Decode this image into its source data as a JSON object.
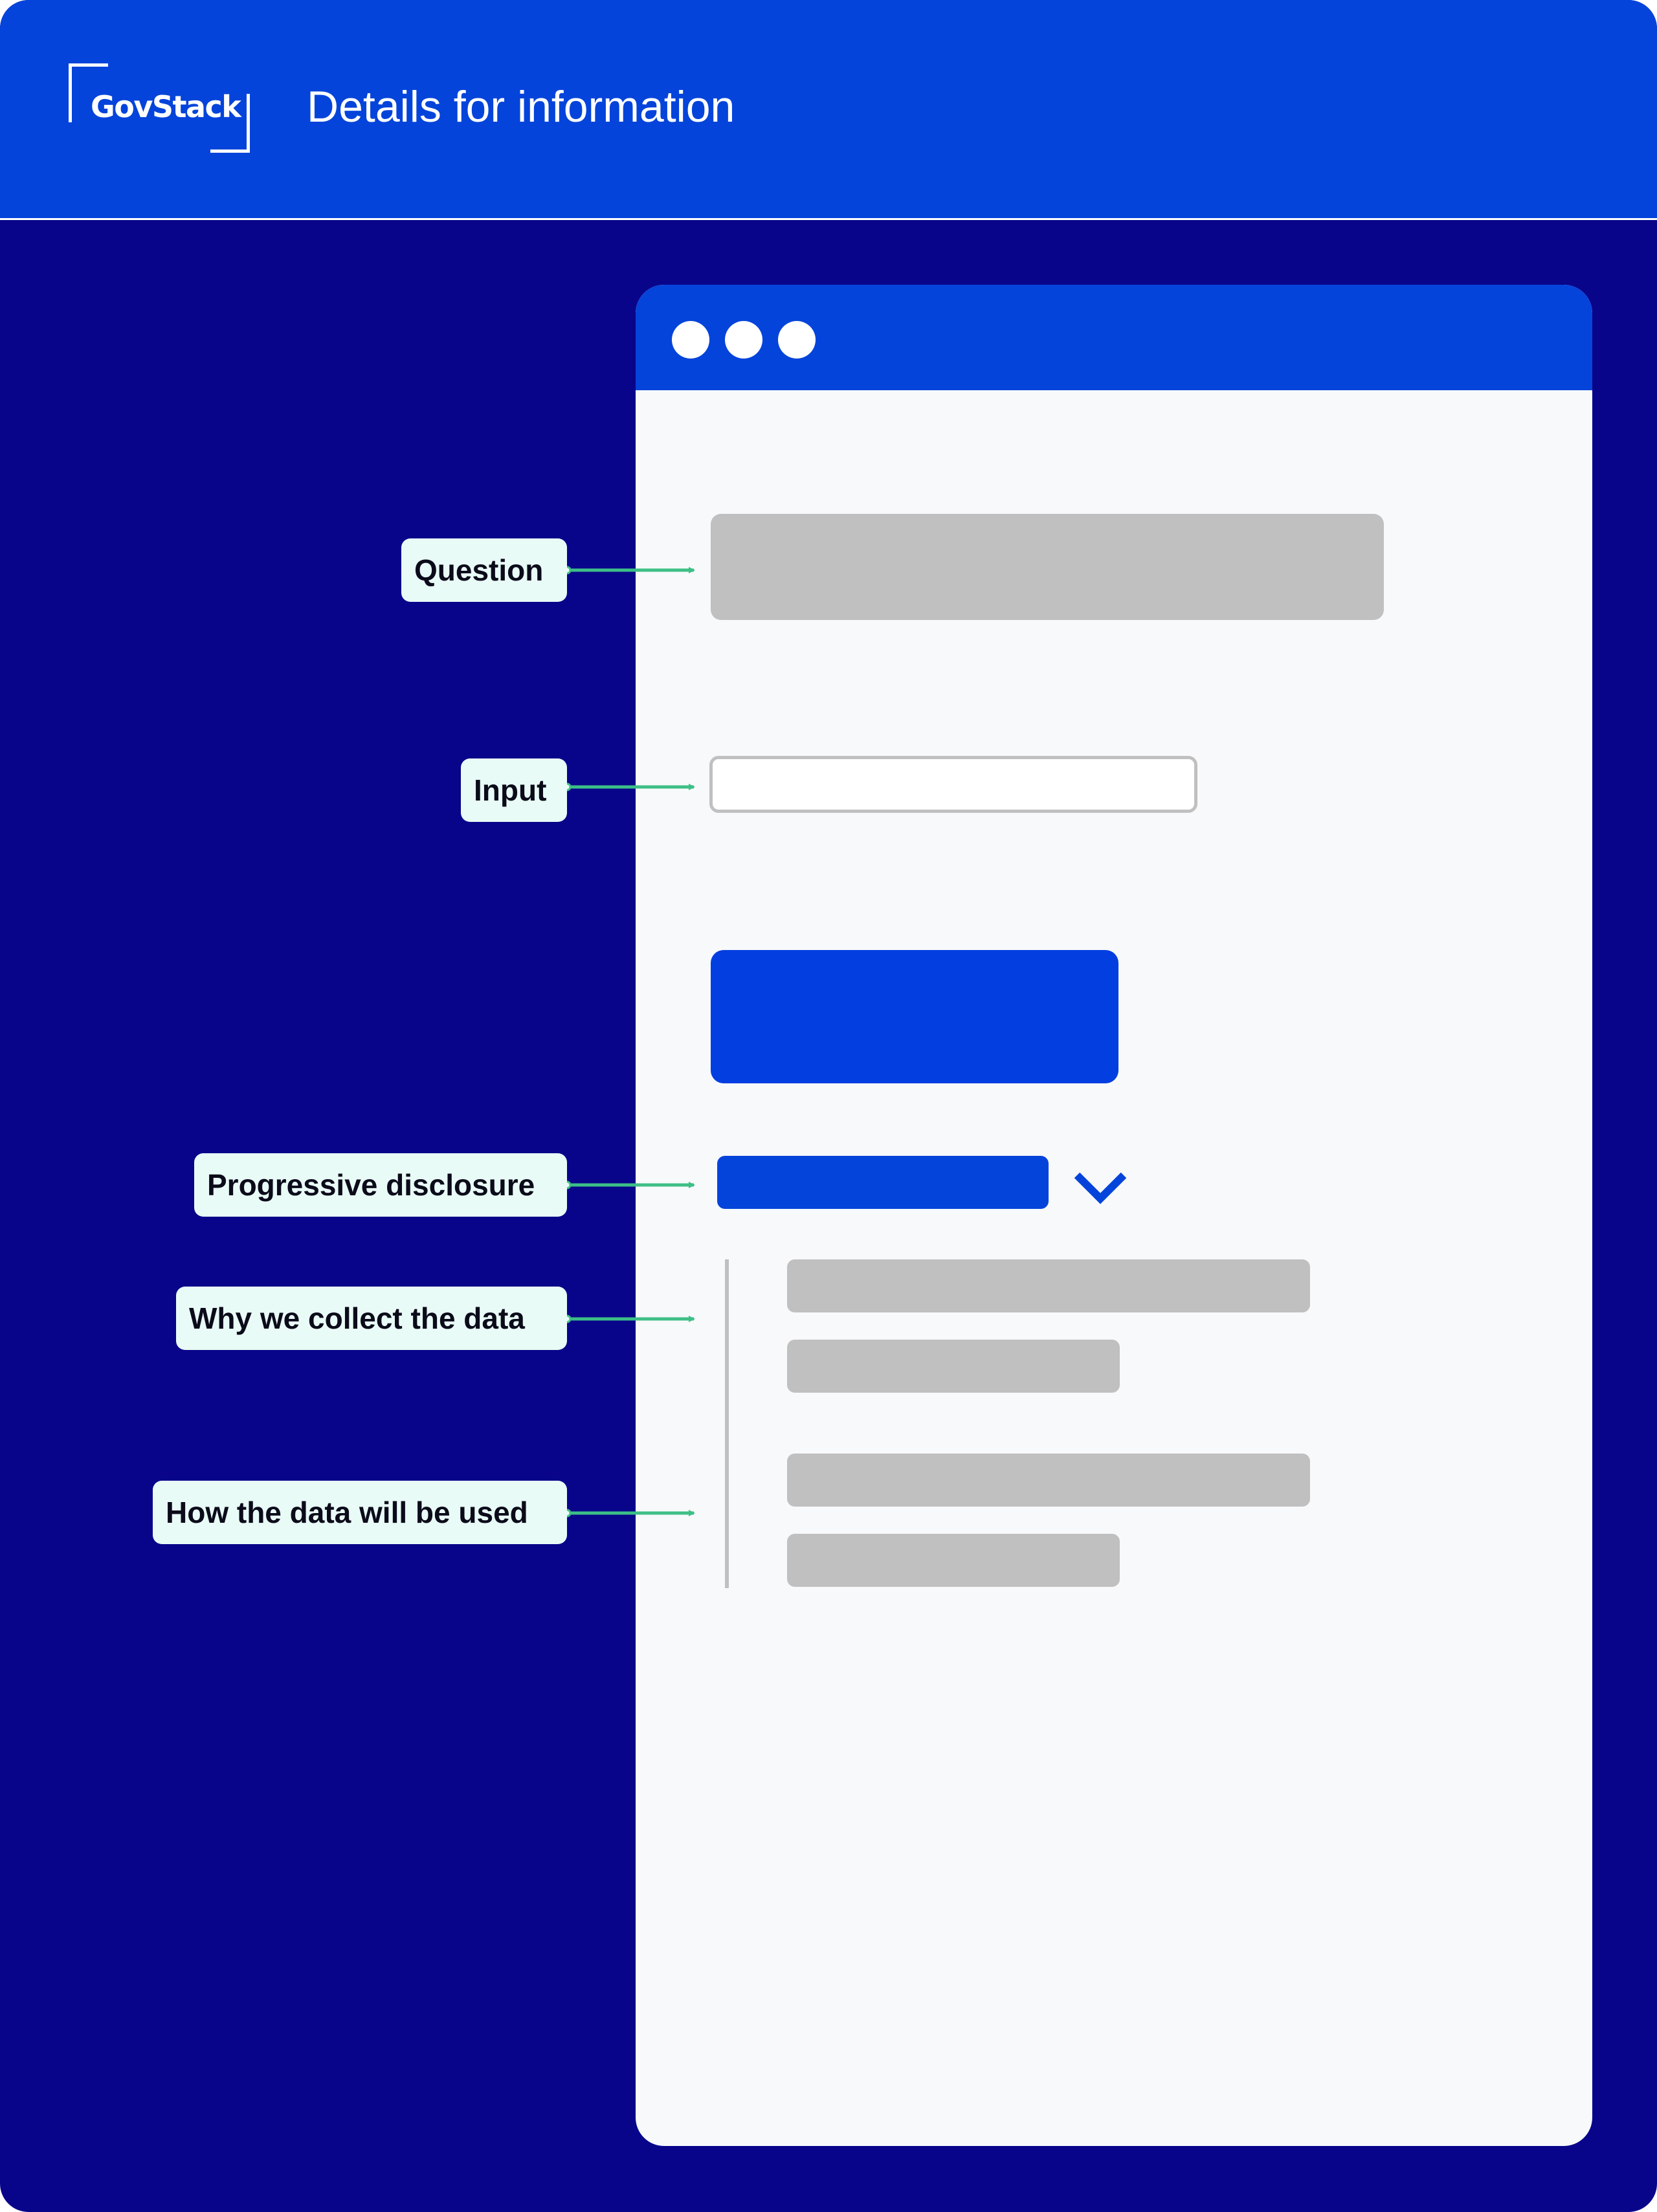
{
  "header": {
    "logo_text": "GovStack",
    "title": "Details for information"
  },
  "annotations": [
    {
      "key": "question",
      "label": "Question"
    },
    {
      "key": "input",
      "label": "Input"
    },
    {
      "key": "progressive_disclosure",
      "label": "Progressive disclosure"
    },
    {
      "key": "why",
      "label": "Why we collect the data"
    },
    {
      "key": "how",
      "label": "How the data will be used"
    }
  ],
  "colors": {
    "background": "#09058a",
    "header": "#0544da",
    "primary_button": "#023ee0",
    "annotation_label_bg": "#e9fbf6",
    "arrow": "#3dbf86",
    "placeholder": "#c0c0c0"
  },
  "icons": [
    "chevron-down-icon"
  ]
}
